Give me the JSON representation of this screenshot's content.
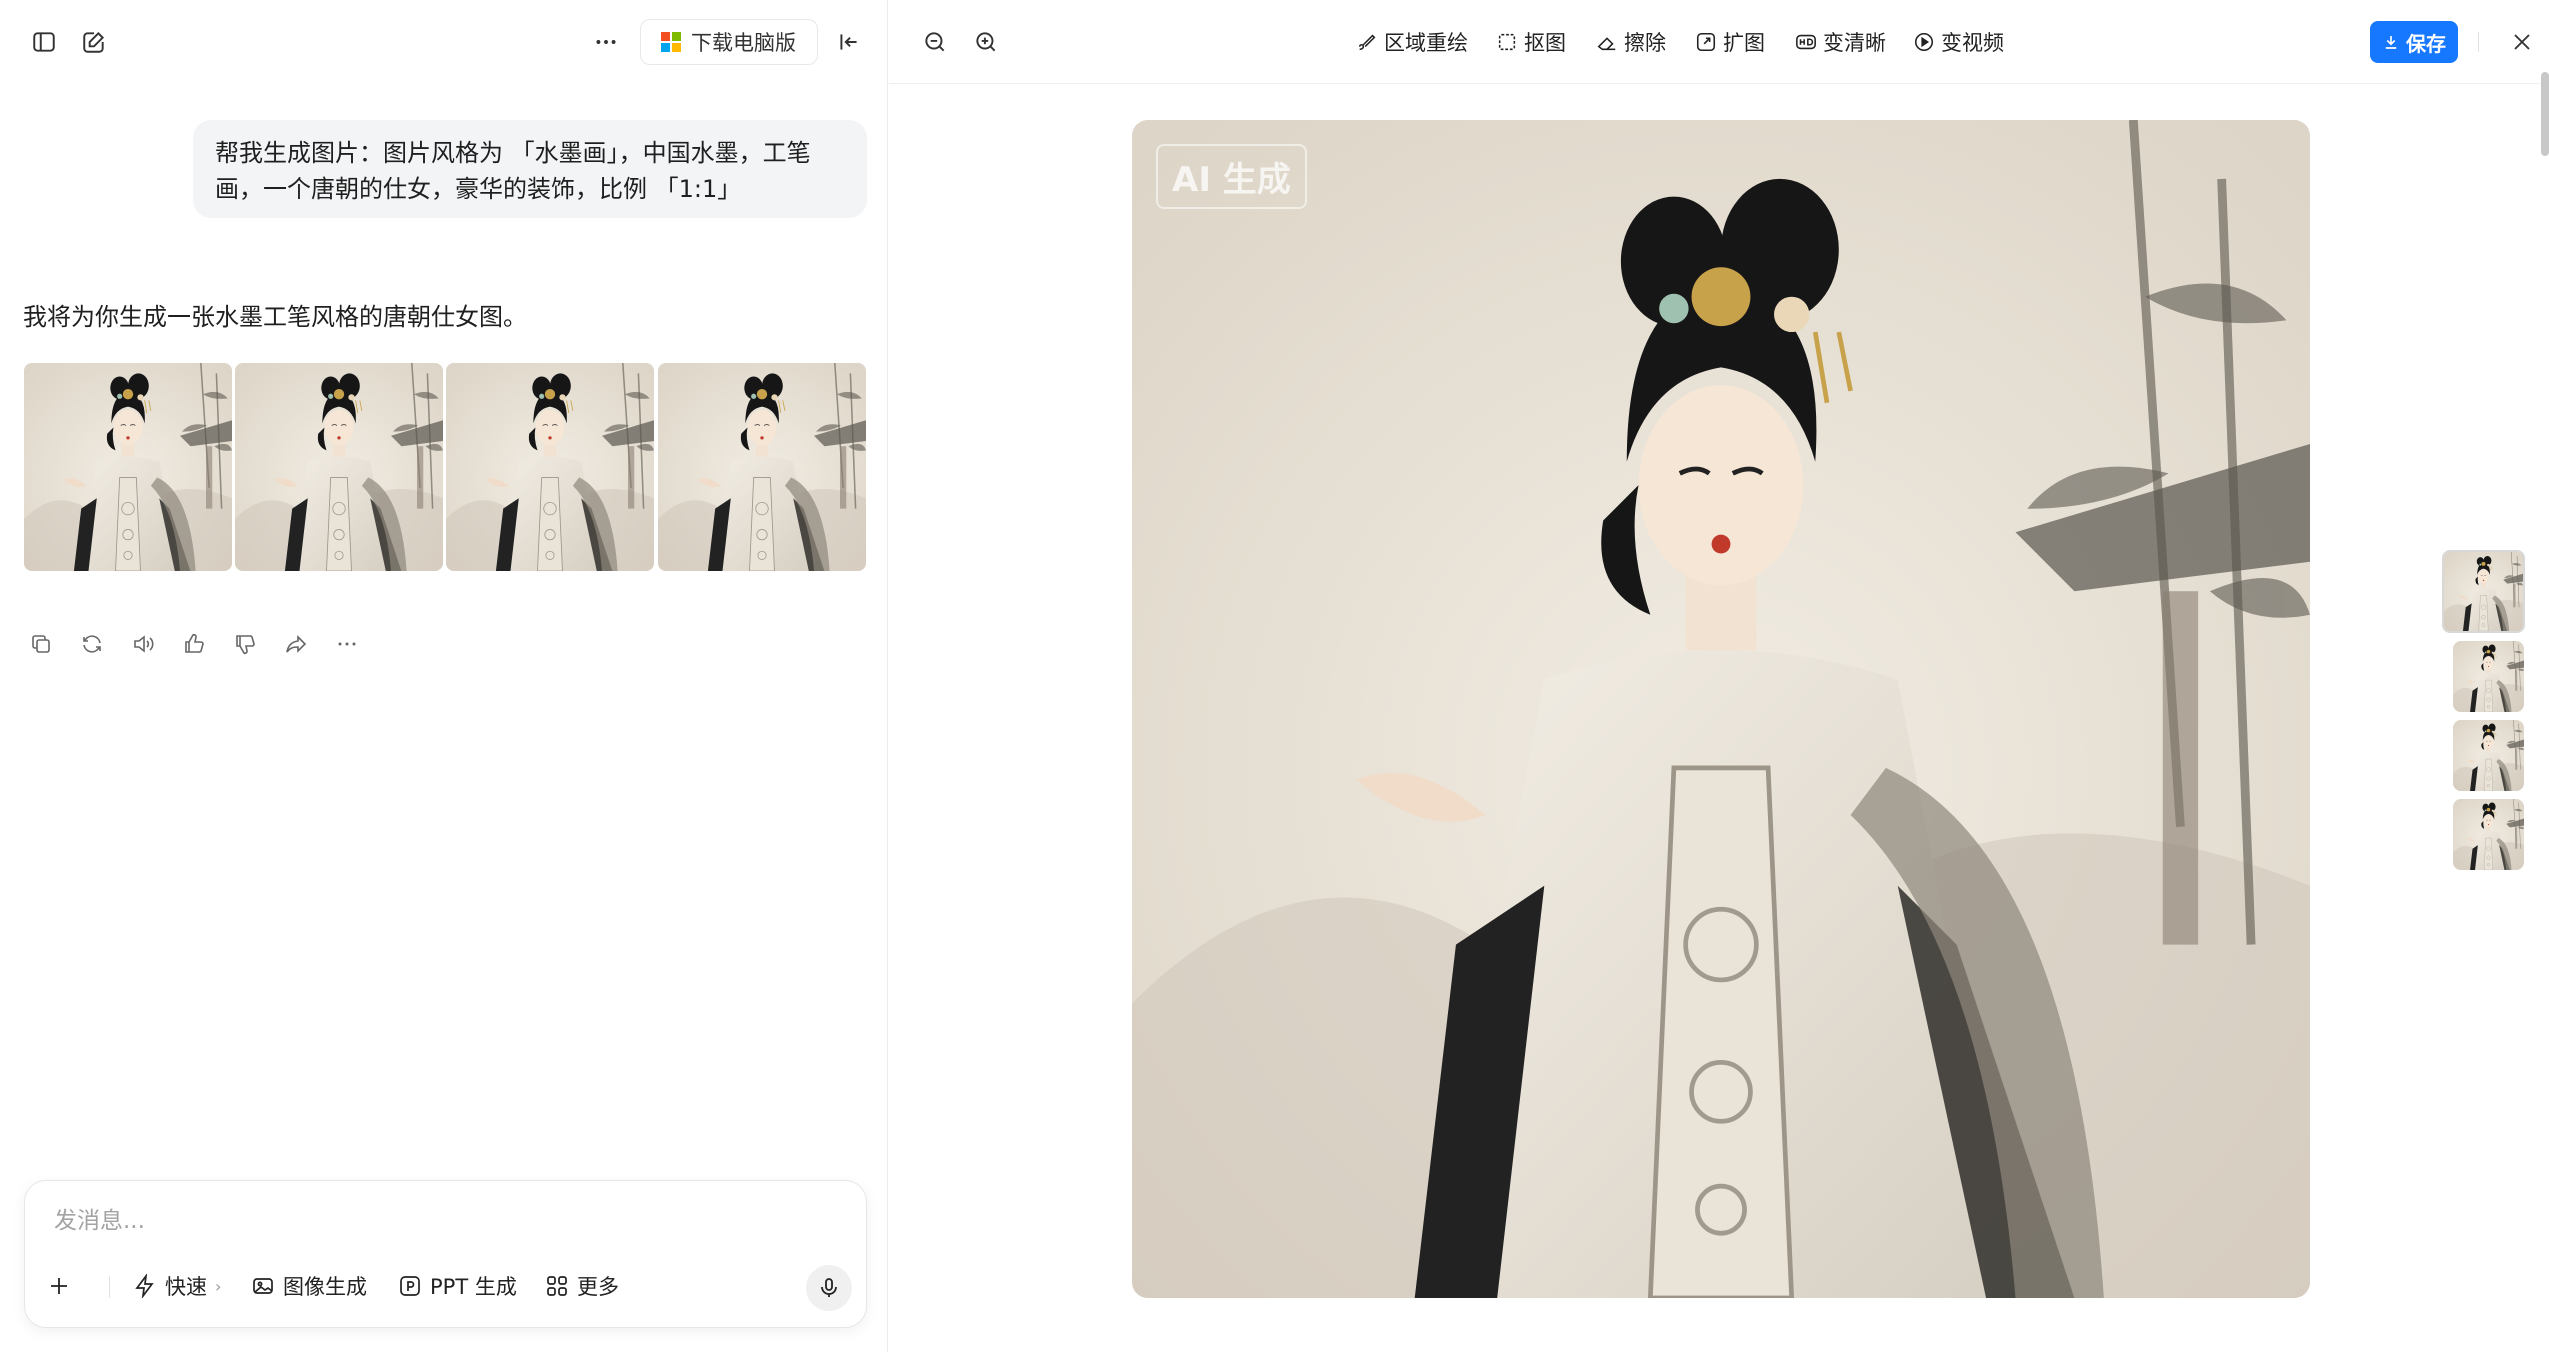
{
  "left": {
    "download_label": "下载电脑版",
    "user_message": "帮我生成图片：图片风格为 「水墨画」，中国水墨，工笔画，一个唐朝的仕女，豪华的装饰，比例 「1:1」",
    "assistant_message": "我将为你生成一张水墨工笔风格的唐朝仕女图。",
    "composer": {
      "placeholder": "发消息...",
      "tools": [
        {
          "label": "快速",
          "icon": "bolt-icon"
        },
        {
          "label": "图像生成",
          "icon": "image-icon"
        },
        {
          "label": "PPT 生成",
          "icon": "ppt-icon"
        },
        {
          "label": "更多",
          "icon": "grid-icon"
        }
      ]
    },
    "actions": [
      "copy-icon",
      "regenerate-icon",
      "speaker-icon",
      "thumbs-up-icon",
      "thumbs-down-icon",
      "share-icon",
      "more-icon"
    ]
  },
  "viewer": {
    "tools": [
      {
        "label": "区域重绘",
        "icon": "brush-icon"
      },
      {
        "label": "抠图",
        "icon": "cutout-icon"
      },
      {
        "label": "擦除",
        "icon": "eraser-icon"
      },
      {
        "label": "扩图",
        "icon": "expand-icon"
      },
      {
        "label": "变清晰",
        "icon": "hd-icon"
      },
      {
        "label": "变视频",
        "icon": "video-icon"
      }
    ],
    "save_label": "保存",
    "watermark": "AI 生成"
  },
  "colors": {
    "accent": "#1677ff",
    "paper": "#ebe5da",
    "ink": "#1b1b1b"
  }
}
